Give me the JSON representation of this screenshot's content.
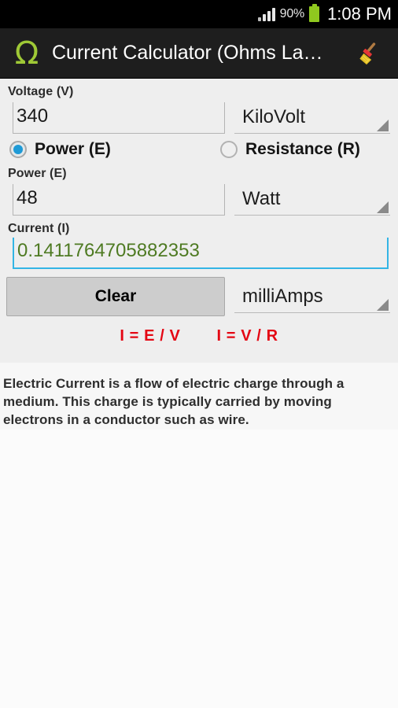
{
  "status_bar": {
    "signal_icon": "signal-bars-icon",
    "battery_percent": "90%",
    "battery_icon": "battery-icon",
    "time": "1:08 PM"
  },
  "action_bar": {
    "logo_glyph": "Ω",
    "logo_icon": "omega-logo-icon",
    "title": "Current Calculator (Ohms La…",
    "clear_icon": "broom-icon"
  },
  "form": {
    "voltage": {
      "label": "Voltage (V)",
      "value": "340",
      "placeholder": "Voltage",
      "unit": "KiloVolt"
    },
    "mode": {
      "power_label": "Power (E)",
      "power_selected": true,
      "resistance_label": "Resistance (R)",
      "resistance_selected": false
    },
    "power": {
      "label": "Power (E)",
      "value": "48",
      "placeholder": "Power",
      "unit": "Watt"
    },
    "current": {
      "label": "Current (I)",
      "value": "0.1411764705882353",
      "placeholder": "Current",
      "unit": "milliAmps"
    },
    "clear_button": "Clear"
  },
  "formulas": {
    "first": "I = E / V",
    "second": "I = V / R"
  },
  "description": "Electric Current is a flow of electric charge through a medium. This charge is typically carried by moving electrons in a conductor such as wire.",
  "colors": {
    "accent_green": "#9fc936",
    "result_green": "#4e7a22",
    "focus_blue": "#33b5e5",
    "radio_blue": "#1e9ad6",
    "formula_red": "#e40613",
    "battery_green": "#8fc81f"
  }
}
